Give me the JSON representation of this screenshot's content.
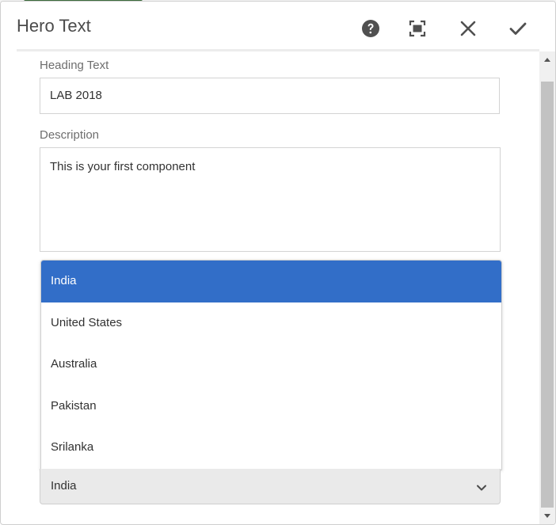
{
  "dialog": {
    "title": "Hero Text",
    "actions": {
      "help_icon": "help-circle-icon",
      "fullscreen_icon": "fullscreen-icon",
      "cancel_icon": "close-icon",
      "confirm_icon": "checkmark-icon"
    }
  },
  "form": {
    "heading": {
      "label": "Heading Text",
      "value": "LAB 2018"
    },
    "description": {
      "label": "Description",
      "value": "This is your first component"
    },
    "country": {
      "selected": "India",
      "options": [
        "India",
        "United States",
        "Australia",
        "Pakistan",
        "Srilanka"
      ],
      "chevron_icon": "chevron-down-icon"
    }
  },
  "colors": {
    "accent": "#326ec8",
    "header_text": "#4b4b4b",
    "label_text": "#6e6e6e",
    "select_bg": "#eaeaea"
  }
}
